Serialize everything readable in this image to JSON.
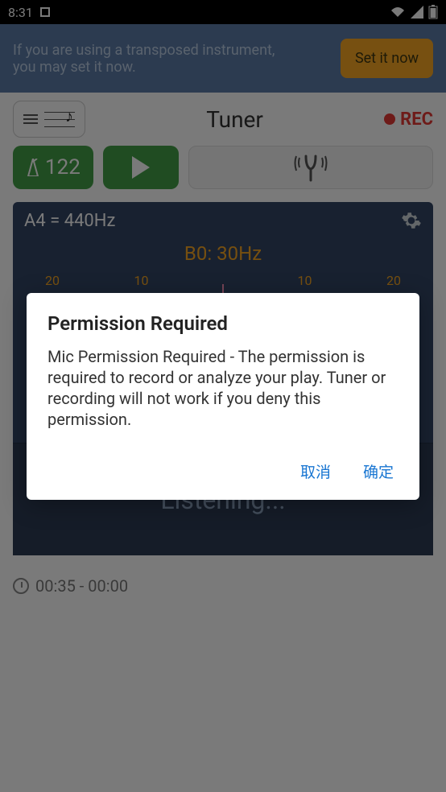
{
  "status": {
    "time": "8:31",
    "icons": {
      "app": "app-icon",
      "wifi": "wifi-icon",
      "signal": "signal-icon",
      "battery": "battery-icon"
    }
  },
  "banner": {
    "text": "If you are using a transposed instrument, you may set it now.",
    "button": "Set it now"
  },
  "toolbar": {
    "title": "Tuner",
    "rec_label": "REC"
  },
  "controls": {
    "tempo": "122"
  },
  "tuner": {
    "reference": "A4 = 440Hz",
    "note": "B0:",
    "freq": "30Hz",
    "scale_labels": [
      "20",
      "10",
      "10",
      "20"
    ],
    "listening_big": "Listening...",
    "listening_small": "Listening..."
  },
  "timecode": "00:35 - 00:00",
  "dialog": {
    "title": "Permission Required",
    "body": "Mic Permission Required - The permission is required to record or analyze your play. Tuner or recording will not work if you deny this permission.",
    "cancel": "取消",
    "ok": "确定"
  }
}
